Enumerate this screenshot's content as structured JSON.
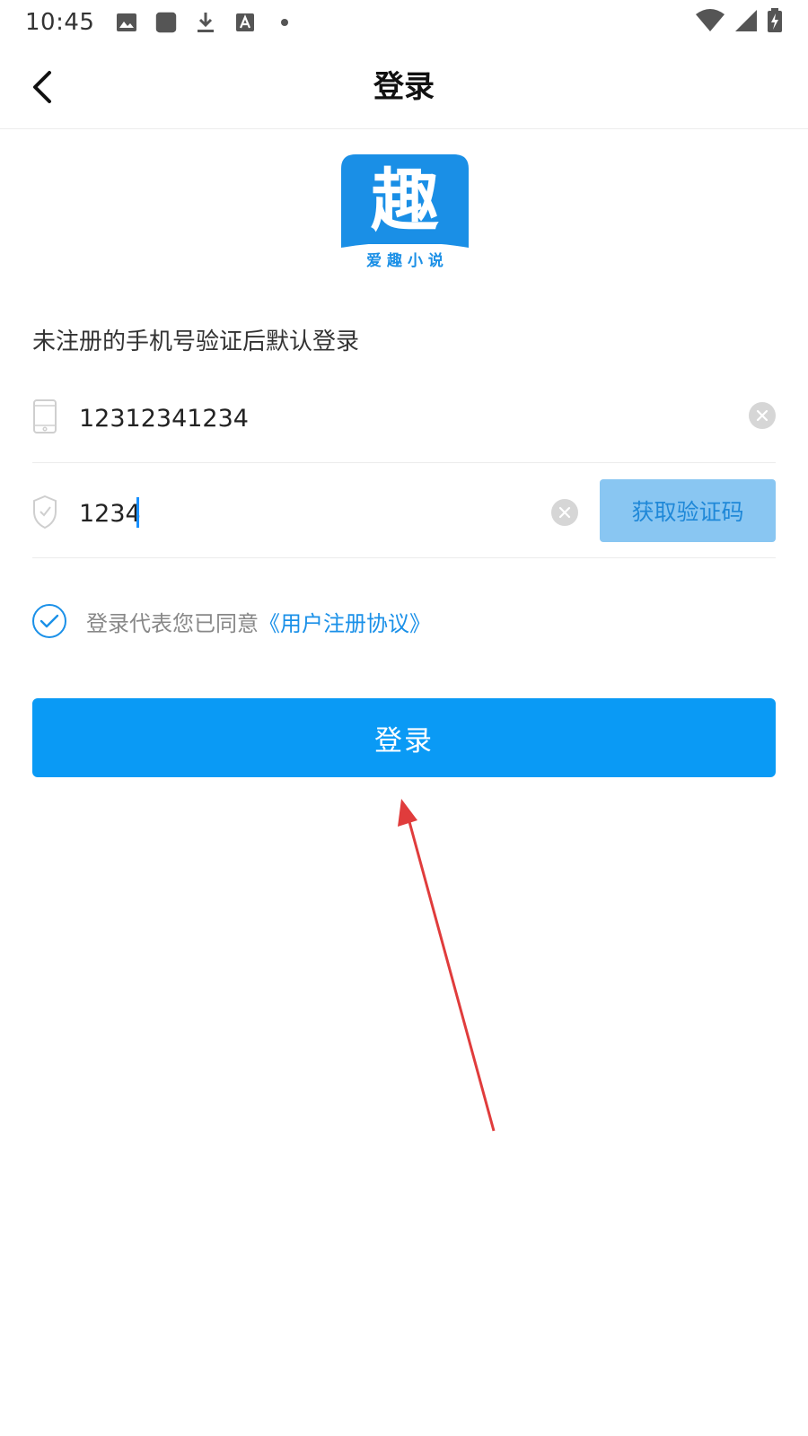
{
  "status_bar": {
    "time": "10:45",
    "left_icons": [
      "image-icon",
      "app-square-icon",
      "download-icon",
      "font-a-icon",
      "dot-icon"
    ],
    "right_icons": [
      "wifi-icon",
      "signal-icon",
      "battery-charging-icon"
    ]
  },
  "nav": {
    "title": "登录",
    "back_icon": "chevron-left-icon"
  },
  "logo": {
    "main_char": "趣",
    "caption": "爱 趣 小 说",
    "color": "#1a8fe6"
  },
  "hint": "未注册的手机号验证后默认登录",
  "phone_field": {
    "value": "12312341234",
    "icon": "phone-icon"
  },
  "code_field": {
    "value": "1234",
    "icon": "shield-check-icon",
    "get_code_label": "获取验证码"
  },
  "agreement": {
    "checked": true,
    "text": "登录代表您已同意",
    "link": "《用户注册协议》"
  },
  "login_button": {
    "label": "登录"
  },
  "colors": {
    "primary": "#0a9af5",
    "link": "#1a90e8",
    "code_button_bg": "#89c6f2",
    "annotation_arrow": "#e03c3c"
  }
}
